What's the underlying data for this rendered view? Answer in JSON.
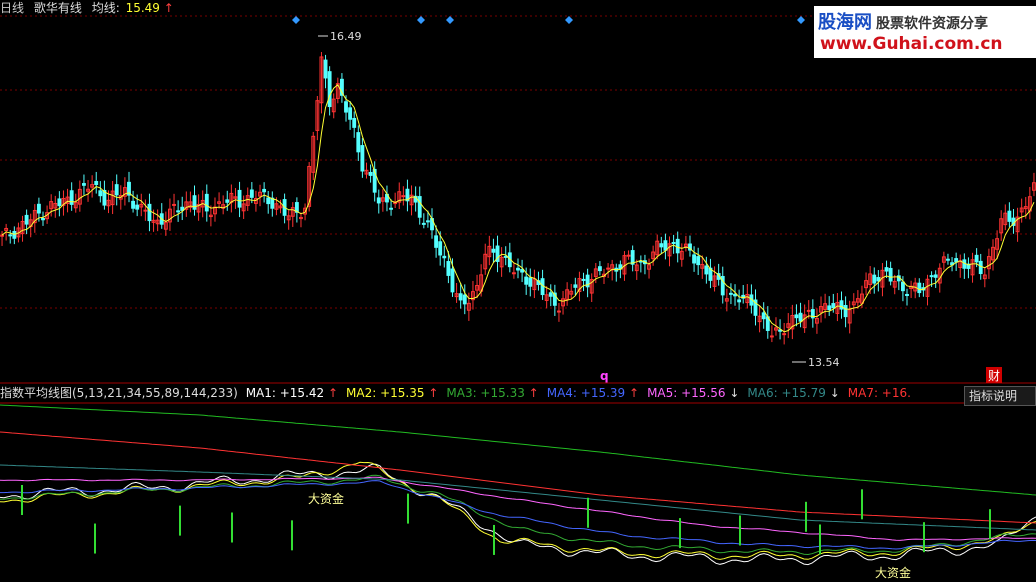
{
  "header": {
    "period": "日线",
    "name": "歌华有线",
    "ma_label": "均线:",
    "ma_value": "15.49",
    "ma_arrow": "↑"
  },
  "logo": {
    "brand": "股海网",
    "slogan": "股票软件资源分享",
    "url": "www.Guhai.com.cn"
  },
  "indicator": {
    "title": "指数平均线图(5,13,21,34,55,89,144,233)",
    "items": [
      {
        "label": "MA1: +15.42",
        "arrow": "↑",
        "color": "#ffffff",
        "arrow_color": "#ff4040"
      },
      {
        "label": "MA2: +15.35",
        "arrow": "↑",
        "color": "#ffff33",
        "arrow_color": "#ff4040"
      },
      {
        "label": "MA3: +15.33",
        "arrow": "↑",
        "color": "#33aa33",
        "arrow_color": "#ff4040"
      },
      {
        "label": "MA4: +15.39",
        "arrow": "↑",
        "color": "#4466ff",
        "arrow_color": "#ff4040"
      },
      {
        "label": "MA5: +15.56",
        "arrow": "↓",
        "color": "#ff66ff",
        "arrow_color": "#dddddd"
      },
      {
        "label": "MA6: +15.79",
        "arrow": "↓",
        "color": "#338888",
        "arrow_color": "#dddddd"
      },
      {
        "label": "MA7: +16.",
        "arrow": "",
        "color": "#ff3333",
        "arrow_color": "#ff4040"
      }
    ],
    "button": "指标说明"
  },
  "markers": {
    "q": "q",
    "cai": "财"
  },
  "chart_data": [
    {
      "type": "candlestick",
      "title": "",
      "annotations": [
        {
          "label": "16.49",
          "value": 16.49
        },
        {
          "label": "13.54",
          "value": 13.54
        },
        {
          "label": "大资金"
        },
        {
          "label": "大资金"
        }
      ],
      "high_value": 16.49,
      "low_value": 13.54,
      "colors": {
        "up": "#ff3333",
        "down": "#54ffff",
        "ma": "#ffff33",
        "grid": "#7a0000"
      },
      "grid": true
    },
    {
      "type": "line",
      "title": "指数平均线图(5,13,21,34,55,89,144,233)",
      "series": [
        {
          "name": "MA1",
          "color": "#ffffff"
        },
        {
          "name": "MA2",
          "color": "#ffff33"
        },
        {
          "name": "MA3",
          "color": "#33aa33"
        },
        {
          "name": "MA4",
          "color": "#4466ff"
        },
        {
          "name": "MA5",
          "color": "#ff66ff"
        },
        {
          "name": "MA6",
          "color": "#338888"
        },
        {
          "name": "MA7",
          "color": "#ff3333"
        }
      ]
    }
  ]
}
